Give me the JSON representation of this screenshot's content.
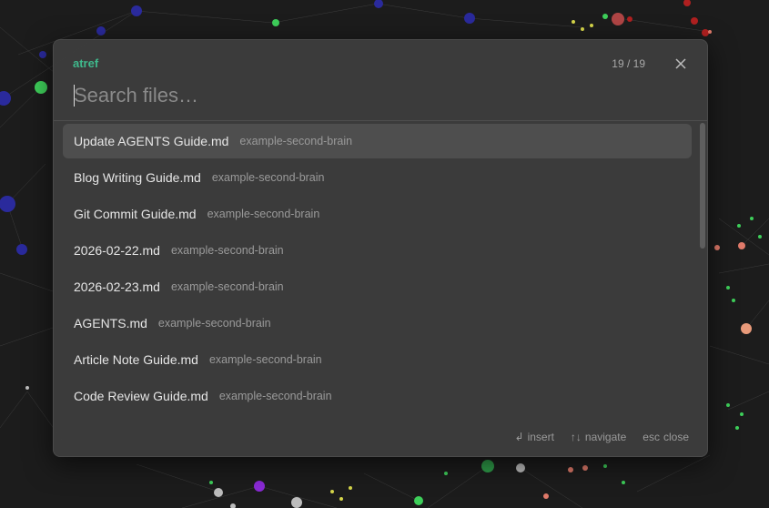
{
  "modal": {
    "plugin_label": "atref",
    "counter": "19 / 19",
    "close_icon": "close-icon",
    "search_placeholder": "Search files…",
    "search_value": ""
  },
  "results": [
    {
      "name": "Update AGENTS Guide.md",
      "path": "example-second-brain",
      "selected": true
    },
    {
      "name": "Blog Writing Guide.md",
      "path": "example-second-brain",
      "selected": false
    },
    {
      "name": "Git Commit Guide.md",
      "path": "example-second-brain",
      "selected": false
    },
    {
      "name": "2026-02-22.md",
      "path": "example-second-brain",
      "selected": false
    },
    {
      "name": "2026-02-23.md",
      "path": "example-second-brain",
      "selected": false
    },
    {
      "name": "AGENTS.md",
      "path": "example-second-brain",
      "selected": false
    },
    {
      "name": "Article Note Guide.md",
      "path": "example-second-brain",
      "selected": false
    },
    {
      "name": "Code Review Guide.md",
      "path": "example-second-brain",
      "selected": false
    }
  ],
  "footer": {
    "insert_key": "↲",
    "insert_label": "insert",
    "navigate_key": "↑↓",
    "navigate_label": "navigate",
    "close_key": "esc",
    "close_label": "close"
  },
  "colors": {
    "accent": "#3fb98c",
    "selected_row": "#4e4e4e",
    "modal_bg": "#3c3c3c",
    "background": "#1c1c1c"
  }
}
